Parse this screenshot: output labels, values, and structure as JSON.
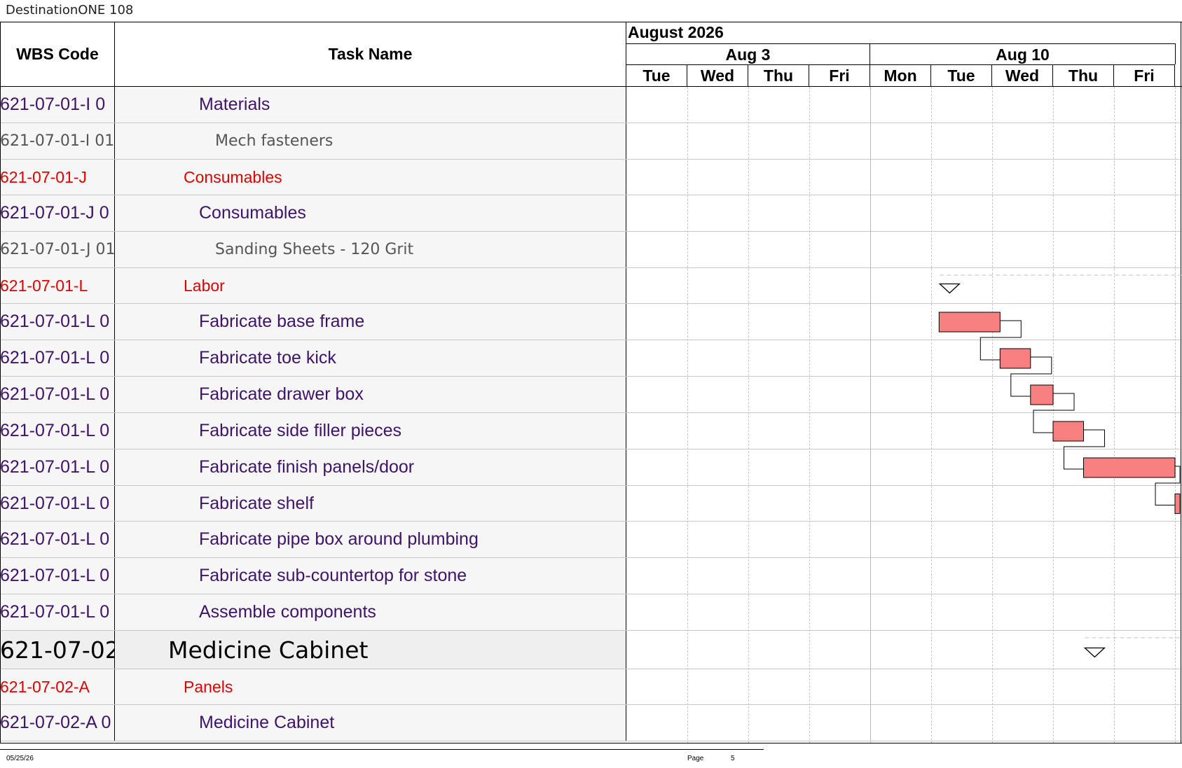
{
  "document": {
    "title": "DestinationONE 108"
  },
  "header": {
    "wbs_label": "WBS Code",
    "task_label": "Task Name",
    "month": "August 2026",
    "weeks": [
      {
        "label": "Aug 3"
      },
      {
        "label": "Aug 10"
      }
    ],
    "days": [
      "Tue",
      "Wed",
      "Thu",
      "Fri",
      "Mon",
      "Tue",
      "Wed",
      "Thu",
      "Fri"
    ]
  },
  "rows": [
    {
      "wbs": "621-07-01-I 0",
      "task": "Materials",
      "level": "task"
    },
    {
      "wbs": "621-07-01-I 01",
      "task": "Mech fasteners",
      "level": "item"
    },
    {
      "wbs": "621-07-01-J",
      "task": "Consumables",
      "level": "group"
    },
    {
      "wbs": "621-07-01-J 0",
      "task": "Consumables",
      "level": "task"
    },
    {
      "wbs": "621-07-01-J 01",
      "task": "Sanding Sheets - 120 Grit",
      "level": "item"
    },
    {
      "wbs": "621-07-01-L",
      "task": "Labor",
      "level": "group"
    },
    {
      "wbs": "621-07-01-L 0",
      "task": "Fabricate base frame",
      "level": "task"
    },
    {
      "wbs": "621-07-01-L 0",
      "task": "Fabricate toe kick",
      "level": "task"
    },
    {
      "wbs": "621-07-01-L 0",
      "task": "Fabricate drawer box",
      "level": "task"
    },
    {
      "wbs": "621-07-01-L 0",
      "task": "Fabricate side filler pieces",
      "level": "task"
    },
    {
      "wbs": "621-07-01-L 0",
      "task": "Fabricate finish panels/door",
      "level": "task"
    },
    {
      "wbs": "621-07-01-L 0",
      "task": "Fabricate shelf",
      "level": "task"
    },
    {
      "wbs": "621-07-01-L 0",
      "task": "Fabricate pipe box around plumbing",
      "level": "task"
    },
    {
      "wbs": "621-07-01-L 0",
      "task": "Fabricate sub-countertop for stone",
      "level": "task"
    },
    {
      "wbs": "621-07-01-L 0",
      "task": "Assemble components",
      "level": "task"
    },
    {
      "wbs": "621-07-02",
      "task": "Medicine Cabinet",
      "level": "section"
    },
    {
      "wbs": "621-07-02-A",
      "task": "Panels",
      "level": "group"
    },
    {
      "wbs": "621-07-02-A 0",
      "task": "Medicine Cabinet",
      "level": "task"
    }
  ],
  "gantt": {
    "bar_color": "#f88080",
    "summaries": [
      {
        "row": 5,
        "start_day": 5.13
      },
      {
        "row": 15,
        "start_day": 7.51
      }
    ],
    "bars": [
      {
        "row": 6,
        "start_day": 5.13,
        "end_day": 6.13
      },
      {
        "row": 7,
        "start_day": 6.13,
        "end_day": 6.63
      },
      {
        "row": 8,
        "start_day": 6.63,
        "end_day": 7.0
      },
      {
        "row": 9,
        "start_day": 7.0,
        "end_day": 7.5
      },
      {
        "row": 10,
        "start_day": 7.5,
        "end_day": 9.0
      },
      {
        "row": 11,
        "start_day": 9.0,
        "end_day": 9.3
      }
    ]
  },
  "footer": {
    "date": "05/25/26",
    "page_label": "Page",
    "page_number": "5"
  }
}
